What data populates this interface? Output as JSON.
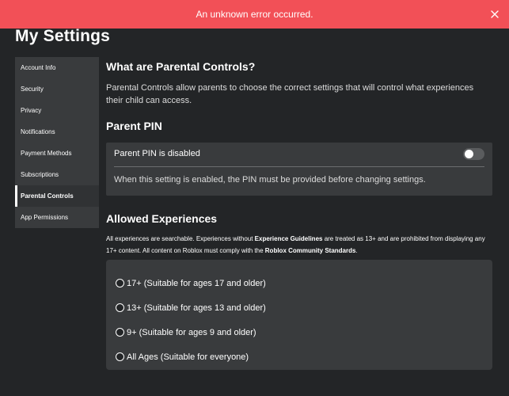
{
  "banner": {
    "message": "An unknown error occurred.",
    "color": "#f25057",
    "close_icon": "close-icon"
  },
  "page": {
    "title": "My Settings"
  },
  "sidebar": {
    "items": [
      {
        "label": "Account Info",
        "active": false
      },
      {
        "label": "Security",
        "active": false
      },
      {
        "label": "Privacy",
        "active": false
      },
      {
        "label": "Notifications",
        "active": false
      },
      {
        "label": "Payment Methods",
        "active": false
      },
      {
        "label": "Subscriptions",
        "active": false
      },
      {
        "label": "Parental Controls",
        "active": true
      },
      {
        "label": "App Permissions",
        "active": false
      }
    ]
  },
  "parental": {
    "heading": "What are Parental Controls?",
    "description": "Parental Controls allow parents to choose the correct settings that will control what experiences their child can access."
  },
  "pin": {
    "heading": "Parent PIN",
    "label": "Parent PIN is disabled",
    "enabled": false,
    "help": "When this setting is enabled, the PIN must be provided before changing settings."
  },
  "allowed": {
    "heading": "Allowed Experiences",
    "desc_part1": "All experiences are searchable. Experiences without ",
    "guidelines_link": "Experience Guidelines",
    "desc_part2": " are treated as 13+ and are prohibited from displaying any 17+ content. All content on Roblox must comply with the ",
    "standards_link": "Roblox Community Standards",
    "desc_part3": ".",
    "options": [
      {
        "label": "17+ (Suitable for ages 17 and older)",
        "selected": false
      },
      {
        "label": "13+ (Suitable for ages 13 and older)",
        "selected": false
      },
      {
        "label": "9+ (Suitable for ages 9 and older)",
        "selected": false
      },
      {
        "label": "All Ages (Suitable for everyone)",
        "selected": false
      }
    ]
  }
}
